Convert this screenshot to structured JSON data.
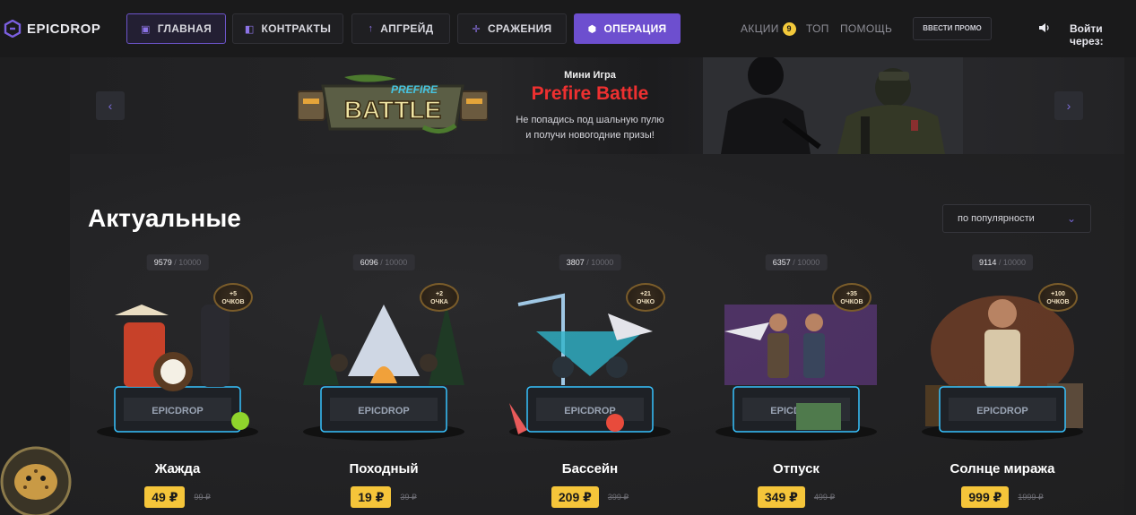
{
  "header": {
    "logo_text": "EPICDROP",
    "nav": [
      {
        "label": "ГЛАВНАЯ",
        "icon": "gift-icon"
      },
      {
        "label": "КОНТРАКТЫ",
        "icon": "contract-icon"
      },
      {
        "label": "АПГРЕЙД",
        "icon": "upgrade-arrow-icon"
      },
      {
        "label": "СРАЖЕНИЯ",
        "icon": "crosshair-icon"
      },
      {
        "label": "ОПЕРАЦИЯ",
        "icon": "shield-icon"
      }
    ],
    "links": {
      "promotions": "АКЦИИ",
      "promotions_badge": "9",
      "top": "ТОП",
      "help": "ПОМОЩЬ"
    },
    "promo_button": "ВВЕСТИ ПРОМО",
    "login_label": "Войти через:"
  },
  "banner": {
    "mini_label": "Мини Игра",
    "title": "Prefire Battle",
    "desc_line1": "Не попадись под шальную пулю",
    "desc_line2": "и получи новогодние призы!",
    "logo_top": "PREFIRE",
    "logo_main": "BATTLE",
    "prev_arrow": "‹",
    "next_arrow": "›"
  },
  "section": {
    "title": "Актуальные",
    "sort_label": "по популярности"
  },
  "cases": [
    {
      "name": "Жажда",
      "count": "9579",
      "max": "10000",
      "points": "+5",
      "points_unit": "ОЧКОВ",
      "price": "49 ₽",
      "old_price": "99 ₽",
      "accent": "#d9452a"
    },
    {
      "name": "Походный",
      "count": "6096",
      "max": "10000",
      "points": "+2",
      "points_unit": "ОЧКА",
      "price": "19 ₽",
      "old_price": "39 ₽",
      "accent": "#e9862b"
    },
    {
      "name": "Бассейн",
      "count": "3807",
      "max": "10000",
      "points": "+21",
      "points_unit": "ОЧКО",
      "price": "209 ₽",
      "old_price": "399 ₽",
      "accent": "#2fb4c9"
    },
    {
      "name": "Отпуск",
      "count": "6357",
      "max": "10000",
      "points": "+35",
      "points_unit": "ОЧКОВ",
      "price": "349 ₽",
      "old_price": "499 ₽",
      "accent": "#9b4dd6"
    },
    {
      "name": "Солнце миража",
      "count": "9114",
      "max": "10000",
      "points": "+100",
      "points_unit": "ОЧКОВ",
      "price": "999 ₽",
      "old_price": "1999 ₽",
      "accent": "#d9642a"
    }
  ],
  "colors": {
    "accent": "#6d4fcf",
    "price": "#f5c53a",
    "title_red": "#ee3030"
  }
}
